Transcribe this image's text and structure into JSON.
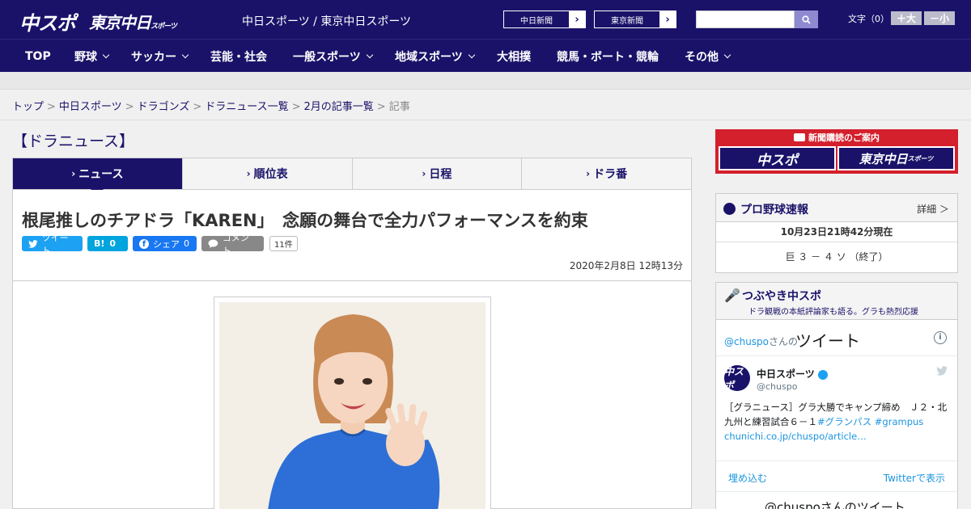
{
  "header": {
    "logo_chuspo": "中スポ",
    "logo_tokyo": "東京中日",
    "logo_tokyo_small": "スポーツ",
    "site_title": "中日スポーツ / 東京中日スポーツ",
    "paper_links": [
      "中日新聞",
      "東京新聞"
    ],
    "search_placeholder": "",
    "fontsize_label": "文字（0）",
    "fontsize_up": "＋大",
    "fontsize_down": "－小"
  },
  "nav": {
    "items": [
      {
        "label": "TOP",
        "dropdown": false
      },
      {
        "label": "野球",
        "dropdown": true
      },
      {
        "label": "サッカー",
        "dropdown": true
      },
      {
        "label": "芸能・社会",
        "dropdown": false
      },
      {
        "label": "一般スポーツ",
        "dropdown": true
      },
      {
        "label": "地域スポーツ",
        "dropdown": true
      },
      {
        "label": "大相撲",
        "dropdown": false
      },
      {
        "label": "競馬・ボート・競輪",
        "dropdown": false
      },
      {
        "label": "その他",
        "dropdown": true
      }
    ]
  },
  "breadcrumb": {
    "items": [
      "トップ",
      "中日スポーツ",
      "ドラゴンズ",
      "ドラニュース一覧",
      "2月の記事一覧"
    ],
    "current": "記事",
    "separator": ">"
  },
  "section_title": "【ドラニュース】",
  "tabs": [
    {
      "label": "ニュース",
      "active": true
    },
    {
      "label": "順位表",
      "active": false
    },
    {
      "label": "日程",
      "active": false
    },
    {
      "label": "ドラ番",
      "active": false
    }
  ],
  "article": {
    "headline": "根尾推しのチアドラ「KAREN」　念願の舞台で全力パフォーマンスを約束",
    "share": {
      "tweet": "ツイート",
      "hatena": "B!",
      "hatena_count": "0",
      "facebook": "シェア",
      "facebook_count": "0",
      "comment": "コメント",
      "comment_count": "11件"
    },
    "published": "2020年2月8日 12時13分"
  },
  "sidebar": {
    "subscribe_title": "新聞購読のご案内",
    "subscribe_logo_1": "中スポ",
    "subscribe_logo_2": "東京中日",
    "subscribe_logo_2_small": "スポーツ",
    "baseball": {
      "title": "プロ野球速報",
      "more": "詳細 ＞",
      "time": "10月23日21時42分現在",
      "score": "巨 ３ － ４ ソ （終了）"
    },
    "tsubuyaki": {
      "title": "つぶやき中スポ",
      "subtitle": "ドラ観戦の本紙評論家も語る。グラも熱烈応援",
      "tw_header_handle": "@chuspo",
      "tw_header_san": "さんの",
      "tw_header_big": "ツイート",
      "tweet": {
        "avatar": "中スポ",
        "name": "中日スポーツ",
        "handle": "@chuspo",
        "text": "［グラニュース］グラ大勝でキャンプ締め　Ｊ２・北九州と練習試合６－１",
        "hashtags": "#グランパス #grampus",
        "link": "chunichi.co.jp/chuspo/article…"
      },
      "embed": "埋め込む",
      "view_on_twitter": "Twitterで表示",
      "bottom_text": "@chuspoさんのツイート"
    }
  },
  "colors": {
    "brand": "#1a1269",
    "subscribe_red": "#d41f2c",
    "twitter": "#1da1f2",
    "facebook": "#1877f2",
    "hatena": "#00a4de"
  }
}
